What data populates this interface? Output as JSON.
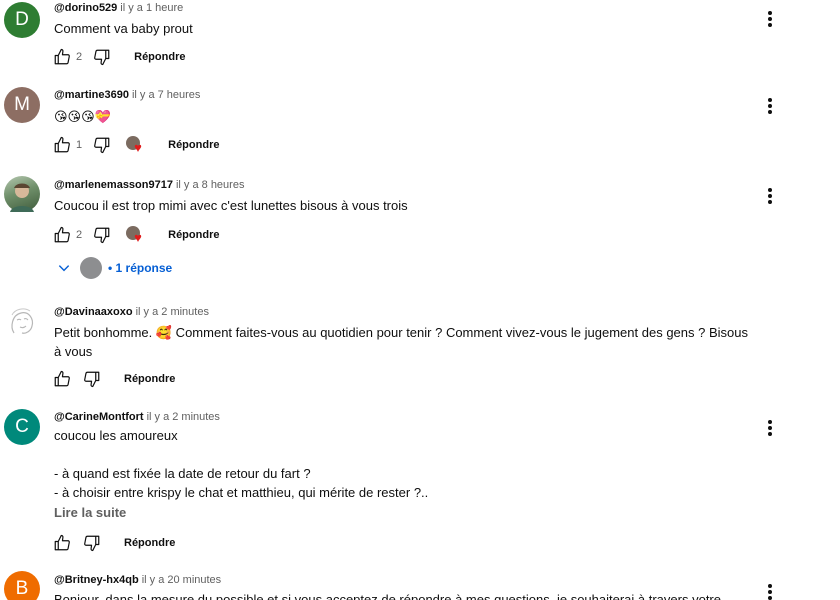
{
  "comments": [
    {
      "author": "@dorino529",
      "time": "il y a 1 heure",
      "avatar_letter": "D",
      "avatar_color": "#2e7d32",
      "lines": [
        "Comment va baby prout"
      ],
      "likes": "2",
      "reply_label": "Répondre"
    },
    {
      "author": "@martine3690",
      "time": "il y a 7 heures",
      "avatar_letter": "M",
      "avatar_color": "#8d6e63",
      "lines": [
        "😘😘😘💝"
      ],
      "likes": "1",
      "reply_label": "Répondre"
    },
    {
      "author": "@marlenemasson9717",
      "time": "il y a 8 heures",
      "lines": [
        "Coucou il est trop mimi avec c'est  lunettes bisous à vous trois"
      ],
      "likes": "2",
      "reply_label": "Répondre",
      "replies_label": "• 1 réponse"
    },
    {
      "author": "@Davinaaxoxo",
      "time": "il y a 2 minutes",
      "lines": [
        "Petit bonhomme. 🥰 Comment faites-vous au quotidien pour tenir ? Comment vivez-vous le jugement des gens ? Bisous",
        "à vous"
      ],
      "reply_label": "Répondre"
    },
    {
      "author": "@CarineMontfort",
      "time": "il y a 2 minutes",
      "avatar_letter": "C",
      "avatar_color": "#00897b",
      "lines": [
        "coucou les amoureux",
        "",
        "- à quand est fixée la date de retour du fart ?",
        "- à choisir entre krispy le chat et matthieu, qui mérite de rester ?.."
      ],
      "read_more": "Lire la suite",
      "reply_label": "Répondre"
    },
    {
      "author": "@Britney-hx4qb",
      "time": "il y a 20 minutes",
      "avatar_letter": "B",
      "avatar_color": "#ef6c00",
      "lines": [
        "Bonjour, dans la mesure du possible et si vous acceptez de répondre à mes questions, je souhaiterai à travers votre"
      ]
    }
  ],
  "icons": {
    "like": "thumb-up-icon",
    "dislike": "thumb-down-icon",
    "menu": "more-vert-icon",
    "creator_heart": "creator-heart-icon",
    "expand": "chevron-down-icon"
  },
  "colors": {
    "link": "#065fd4",
    "heart": "#e01a1a"
  }
}
